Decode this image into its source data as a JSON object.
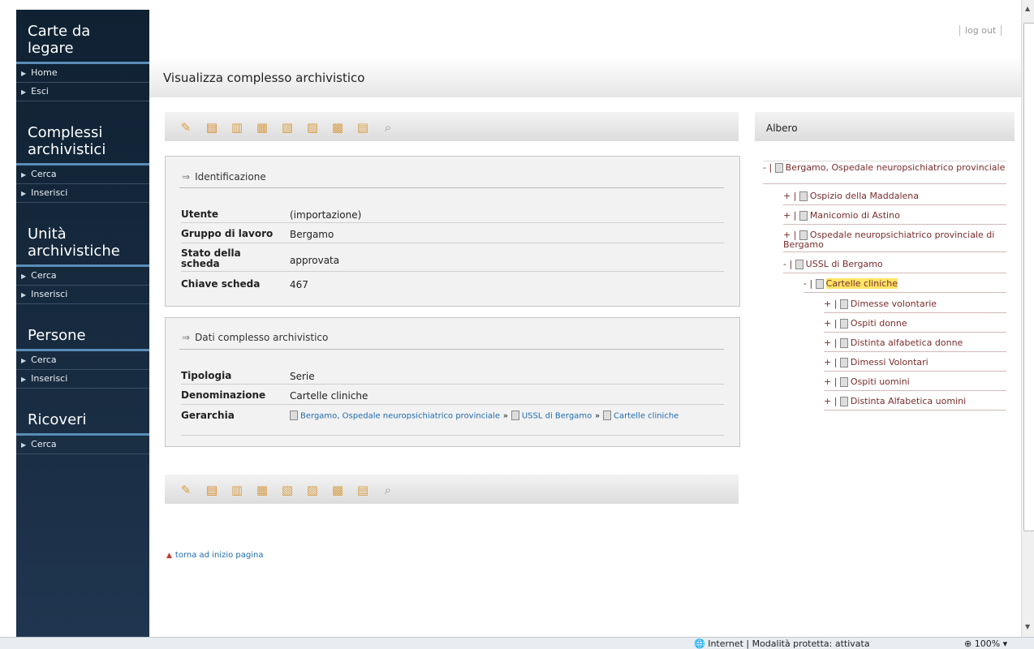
{
  "sidebar": {
    "app_title": "Carte da legare",
    "nav": [
      {
        "label": "Home"
      },
      {
        "label": "Esci"
      }
    ],
    "sections": [
      {
        "title": "Complessi archivistici",
        "items": [
          {
            "label": "Cerca"
          },
          {
            "label": "Inserisci"
          }
        ]
      },
      {
        "title": "Unità archivistiche",
        "items": [
          {
            "label": "Cerca"
          },
          {
            "label": "Inserisci"
          }
        ]
      },
      {
        "title": "Persone",
        "items": [
          {
            "label": "Cerca"
          },
          {
            "label": "Inserisci"
          }
        ]
      },
      {
        "title": "Ricoveri",
        "items": [
          {
            "label": "Cerca"
          }
        ]
      }
    ]
  },
  "header": {
    "logout_label": "log out",
    "page_title": "Visualizza complesso archivistico"
  },
  "toolbar": {
    "icons": [
      "edit-icon",
      "delete-icon",
      "list-icon",
      "move-icon",
      "add-child-icon",
      "add-sibling-icon",
      "add-group-icon",
      "tree-icon",
      "preview-icon"
    ]
  },
  "identificazione": {
    "title": "Identificazione",
    "rows": [
      {
        "label": "Utente",
        "value": "(importazione)"
      },
      {
        "label": "Gruppo di lavoro",
        "value": "Bergamo"
      },
      {
        "label": "Stato della scheda",
        "value": "approvata"
      },
      {
        "label": "Chiave scheda",
        "value": "467"
      }
    ]
  },
  "dati": {
    "title": "Dati complesso archivistico",
    "rows": [
      {
        "label": "Tipologia",
        "value": "Serie"
      },
      {
        "label": "Denominazione",
        "value": "Cartelle cliniche"
      }
    ],
    "gerarchia_label": "Gerarchia",
    "gerarchia": [
      "Bergamo, Ospedale neuropsichiatrico provinciale",
      "USSL di Bergamo",
      "Cartelle cliniche"
    ]
  },
  "tree": {
    "title": "Albero",
    "nodes": [
      {
        "sym": "- |",
        "label": "Bergamo, Ospedale neuropsichiatrico provinciale"
      },
      {
        "sym": "+ |",
        "label": "Ospizio della Maddalena"
      },
      {
        "sym": "+ |",
        "label": "Manicomio di Astino"
      },
      {
        "sym": "+ |",
        "label": "Ospedale neuropsichiatrico provinciale di Bergamo"
      },
      {
        "sym": "- |",
        "label": "USSL di Bergamo"
      },
      {
        "sym": "- |",
        "label": "Cartelle cliniche"
      },
      {
        "sym": "+ |",
        "label": "Dimesse volontarie"
      },
      {
        "sym": "+ |",
        "label": "Ospiti donne"
      },
      {
        "sym": "+ |",
        "label": "Distinta alfabetica donne"
      },
      {
        "sym": "+ |",
        "label": "Dimessi Volontari"
      },
      {
        "sym": "+ |",
        "label": "Ospiti uomini"
      },
      {
        "sym": "+ |",
        "label": "Distinta Alfabetica uomini"
      }
    ]
  },
  "footer": {
    "back_to_top": "torna ad inizio pagina"
  },
  "statusbar": {
    "text": "Internet | Modalità protetta: attivata",
    "zoom": "100%"
  }
}
